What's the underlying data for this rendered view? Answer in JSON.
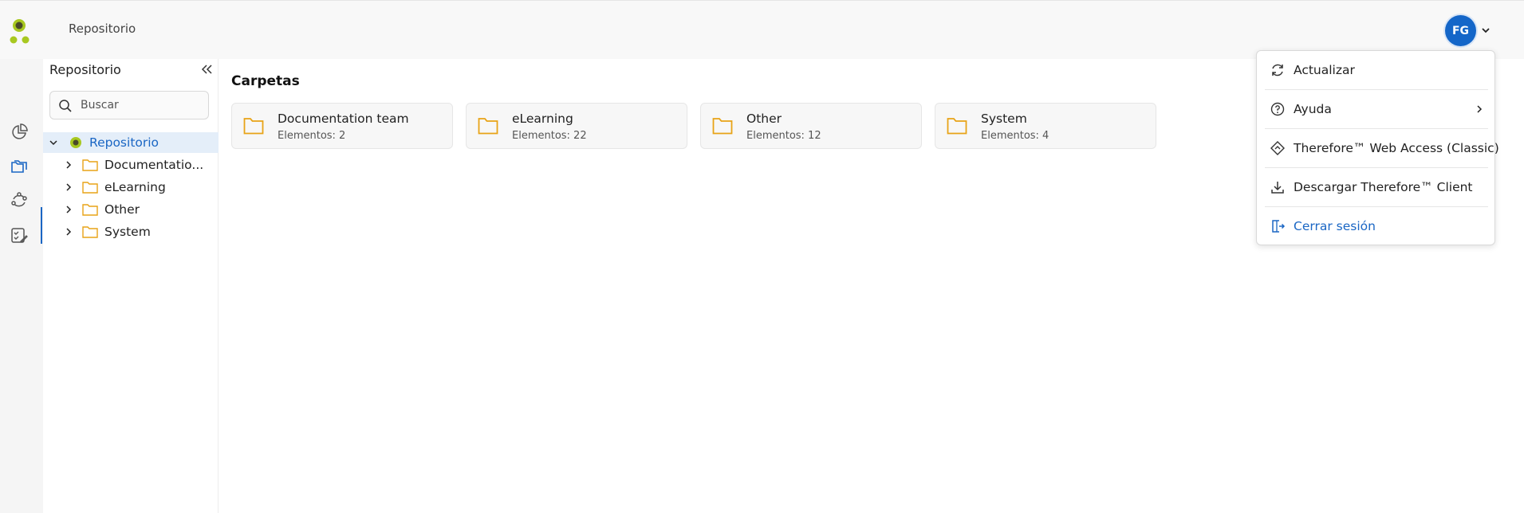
{
  "header": {
    "breadcrumb": "Repositorio",
    "user_initials": "FG"
  },
  "rail": {
    "items": [
      "dashboard-icon",
      "repository-icon",
      "workflow-icon",
      "tasks-icon"
    ]
  },
  "tree": {
    "title": "Repositorio",
    "search_placeholder": "Buscar",
    "root": "Repositorio",
    "items": [
      {
        "label": "Documentatio..."
      },
      {
        "label": "eLearning"
      },
      {
        "label": "Other"
      },
      {
        "label": "System"
      }
    ]
  },
  "main": {
    "section_title": "Carpetas",
    "folders": [
      {
        "name": "Documentation team",
        "count": "Elementos: 2"
      },
      {
        "name": "eLearning",
        "count": "Elementos: 22"
      },
      {
        "name": "Other",
        "count": "Elementos: 12"
      },
      {
        "name": "System",
        "count": "Elementos: 4"
      }
    ]
  },
  "menu": {
    "items": [
      {
        "label": "Actualizar"
      },
      {
        "label": "Ayuda"
      },
      {
        "label": "Therefore™ Web Access (Classic)"
      },
      {
        "label": "Descargar Therefore™ Client"
      },
      {
        "label": "Cerrar sesión"
      }
    ]
  },
  "colors": {
    "accent": "#1a66c4",
    "folder": "#e8a317",
    "logo_dark": "#4a4a2a",
    "logo_green": "#a8c820"
  }
}
